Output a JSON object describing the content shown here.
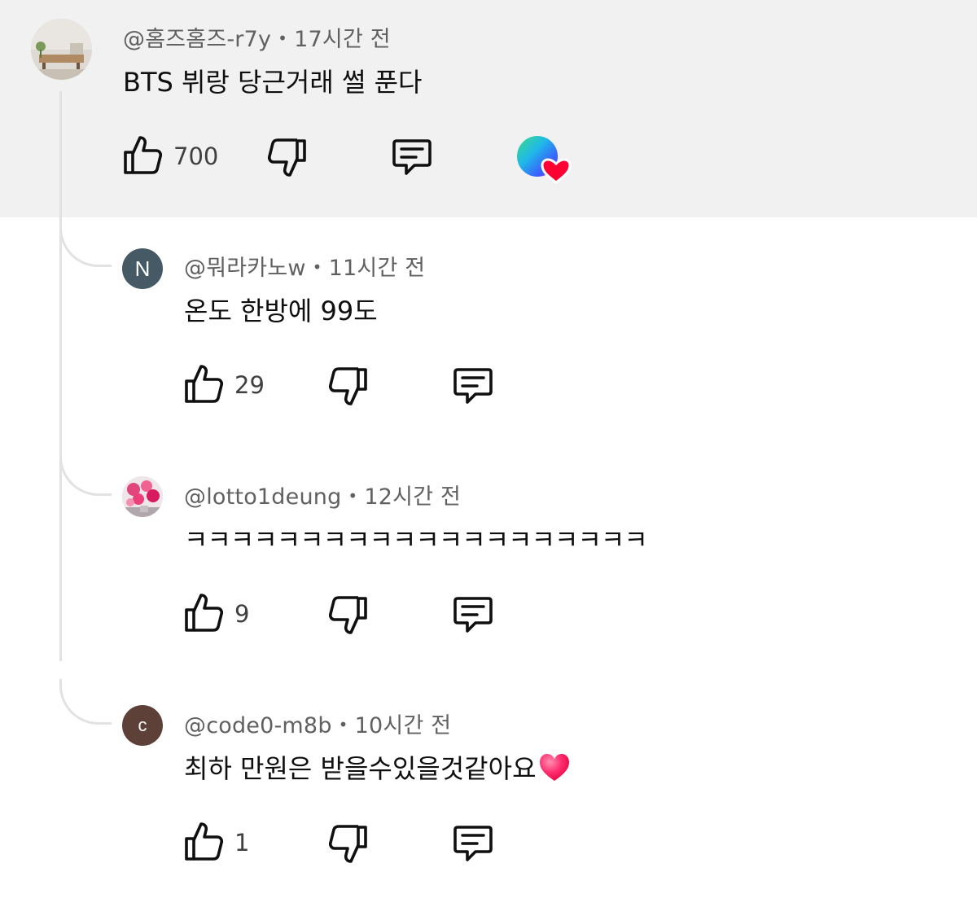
{
  "comments": [
    {
      "handle": "@홈즈홈즈-r7y",
      "time": "17시간 전",
      "text": "BTS 뷔랑 당근거래 썰 푼다",
      "likes": "700",
      "avatar_icon": "photo-avatar",
      "creator_heart": true
    },
    {
      "handle": "@뭐라카노w",
      "time": "11시간 전",
      "text": "온도 한방에 99도",
      "likes": "29",
      "avatar_letter": "N",
      "avatar_color": "#455a64"
    },
    {
      "handle": "@lotto1deung",
      "time": "12시간 전",
      "text": "ㅋㅋㅋㅋㅋㅋㅋㅋㅋㅋㅋㅋㅋㅋㅋㅋㅋㅋㅋㅋ",
      "likes": "9",
      "avatar_icon": "photo-avatar-flowers"
    },
    {
      "handle": "@code0-m8b",
      "time": "10시간 전",
      "text": "최하 만원은 받을수있을것같아요",
      "emoji": "heart-emoji",
      "likes": "1",
      "avatar_letter": "c",
      "avatar_color": "#5d4037"
    }
  ],
  "separator": "•",
  "colors": {
    "highlight_bg": "#f1f1f1",
    "thread_line": "#e2e2e2",
    "text_secondary": "#606060",
    "heart": "#ff0033"
  }
}
